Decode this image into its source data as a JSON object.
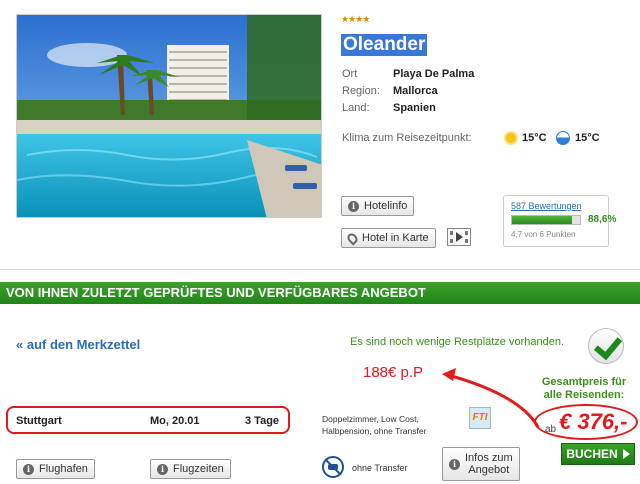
{
  "hotel": {
    "stars": "★★★★",
    "name": "Oleander",
    "details": [
      {
        "label": "Ort",
        "value": "Playa De Palma"
      },
      {
        "label": "Region:",
        "value": "Mallorca"
      },
      {
        "label": "Land:",
        "value": "Spanien"
      }
    ],
    "klima_label": "Klima zum Reisezeitpunkt:",
    "air_temp": "15°C",
    "water_temp": "15°C",
    "hotelinfo_button": "Hotelinfo",
    "map_button": "Hotel in Karte"
  },
  "rating": {
    "reviews_link": "587 Bewertungen",
    "percent_text": "88,6%",
    "percent_value": 88.6,
    "points": "4,7 von 6 Punkten"
  },
  "offer_section": {
    "heading": "VON IHNEN ZULETZT GEPRÜFTES UND VERFÜGBARES ANGEBOT",
    "merkzettel_link": "« auf den Merkzettel",
    "availability": "Es sind noch wenige Restplätze vorhanden.",
    "per_person_note": "188€ p.P",
    "total_label_line1": "Gesamtpreis für",
    "total_label_line2": "alle Reisenden:",
    "departure": "Stuttgart",
    "date": "Mo, 20.01",
    "duration": "3 Tage",
    "board": "Doppelzimmer, Low Cost, Halbpension, ohne Transfer",
    "operator_logo": "FTI",
    "price_prefix": "ab",
    "price": "€ 376,-",
    "transfer_label": "ohne Transfer",
    "flughafen_button": "Flughafen",
    "flugzeiten_button": "Flugzeiten",
    "infos_button_line1": "Infos zum",
    "infos_button_line2": "Angebot",
    "book_button": "BUCHEN"
  },
  "colors": {
    "brand_green": "#2e9a22",
    "link_blue": "#2a6ebb",
    "annotation_red": "#e21a1a"
  }
}
